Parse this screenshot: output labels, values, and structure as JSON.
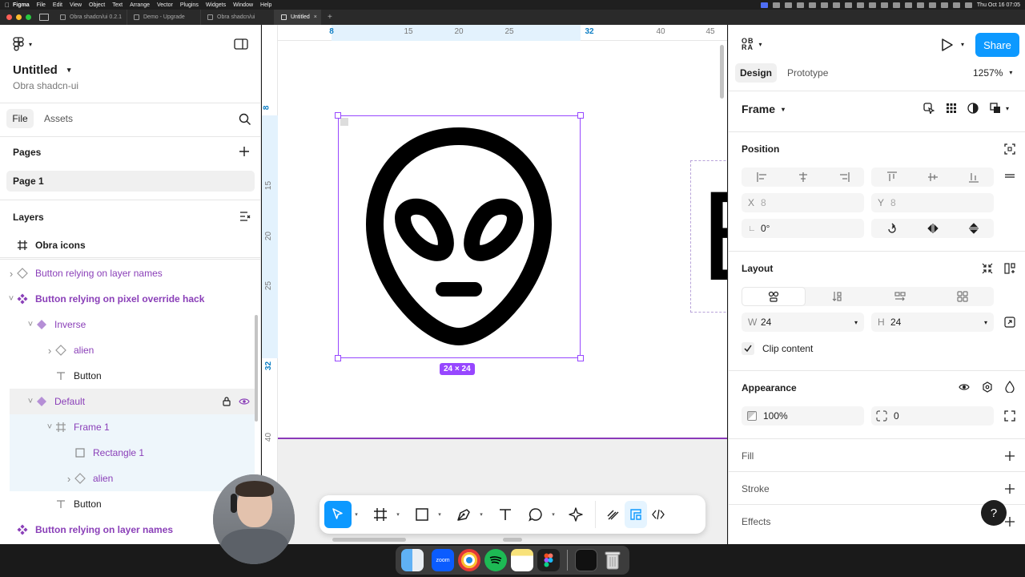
{
  "menubar": {
    "app": "Figma",
    "items": [
      "File",
      "Edit",
      "View",
      "Object",
      "Text",
      "Arrange",
      "Vector",
      "Plugins",
      "Widgets",
      "Window",
      "Help"
    ],
    "clock": "Thu Oct 16 07:05"
  },
  "tabs": [
    {
      "label": "Obra shadcn/ui 0.2.1",
      "active": false
    },
    {
      "label": "Demo - Upgrade",
      "active": false
    },
    {
      "label": "Obra shadcn/ui",
      "active": false
    },
    {
      "label": "Untitled",
      "active": true
    }
  ],
  "left": {
    "file_name": "Untitled",
    "team_name": "Obra shadcn-ui",
    "tab_file": "File",
    "tab_assets": "Assets",
    "pages_title": "Pages",
    "page_1": "Page 1",
    "layers_title": "Layers",
    "layers": [
      {
        "label": "Obra icons",
        "icon": "frame-icon",
        "indent": 0,
        "bold": true,
        "purple": false,
        "chev": ""
      },
      {
        "label": "Button relying on layer names",
        "icon": "instance-icon",
        "indent": 0,
        "bold": false,
        "purple": true,
        "chev": "right"
      },
      {
        "label": "Button relying on pixel override hack",
        "icon": "component-set-icon",
        "indent": 0,
        "bold": true,
        "purple": true,
        "chev": "down"
      },
      {
        "label": "Inverse",
        "icon": "variant-icon",
        "indent": 1,
        "bold": false,
        "purple": true,
        "chev": "down"
      },
      {
        "label": "alien",
        "icon": "instance-icon",
        "indent": 2,
        "bold": false,
        "purple": true,
        "chev": "right"
      },
      {
        "label": "Button",
        "icon": "text-icon",
        "indent": 2,
        "bold": false,
        "purple": false,
        "chev": ""
      },
      {
        "label": "Default",
        "icon": "variant-icon",
        "indent": 1,
        "bold": false,
        "purple": true,
        "chev": "down"
      },
      {
        "label": "Frame 1",
        "icon": "frame-icon",
        "indent": 2,
        "bold": false,
        "purple": true,
        "chev": "down"
      },
      {
        "label": "Rectangle 1",
        "icon": "rectangle-icon",
        "indent": 3,
        "bold": false,
        "purple": true,
        "chev": ""
      },
      {
        "label": "alien",
        "icon": "instance-icon",
        "indent": 3,
        "bold": false,
        "purple": true,
        "chev": "right"
      },
      {
        "label": "Button",
        "icon": "text-icon",
        "indent": 2,
        "bold": false,
        "purple": false,
        "chev": ""
      },
      {
        "label": "Button relying on layer names",
        "icon": "component-set-icon",
        "indent": 0,
        "bold": true,
        "purple": true,
        "chev": ""
      }
    ]
  },
  "canvas": {
    "ruler_top": [
      "8",
      "15",
      "20",
      "25",
      "32",
      "40",
      "45"
    ],
    "ruler_left": [
      "8",
      "15",
      "20",
      "25",
      "32",
      "40"
    ],
    "size_badge": "24 × 24",
    "other_frame_glyph": "E"
  },
  "right": {
    "tab_design": "Design",
    "tab_prototype": "Prototype",
    "zoom": "1257%",
    "share": "Share",
    "frame_label": "Frame",
    "position_title": "Position",
    "x_label": "X",
    "x_value": "8",
    "y_label": "Y",
    "y_value": "8",
    "rotation": "0°",
    "layout_title": "Layout",
    "w_label": "W",
    "w_value": "24",
    "h_label": "H",
    "h_value": "24",
    "clip_content": "Clip content",
    "clip_checked": true,
    "appearance_title": "Appearance",
    "opacity": "100%",
    "radius": "0",
    "fill_title": "Fill",
    "stroke_title": "Stroke",
    "effects_title": "Effects",
    "help": "?"
  },
  "dock": {
    "zoom_label": "zoom"
  },
  "colors": {
    "accent": "#0d99ff",
    "component_purple": "#8a3fb8",
    "selection": "#9747ff"
  }
}
